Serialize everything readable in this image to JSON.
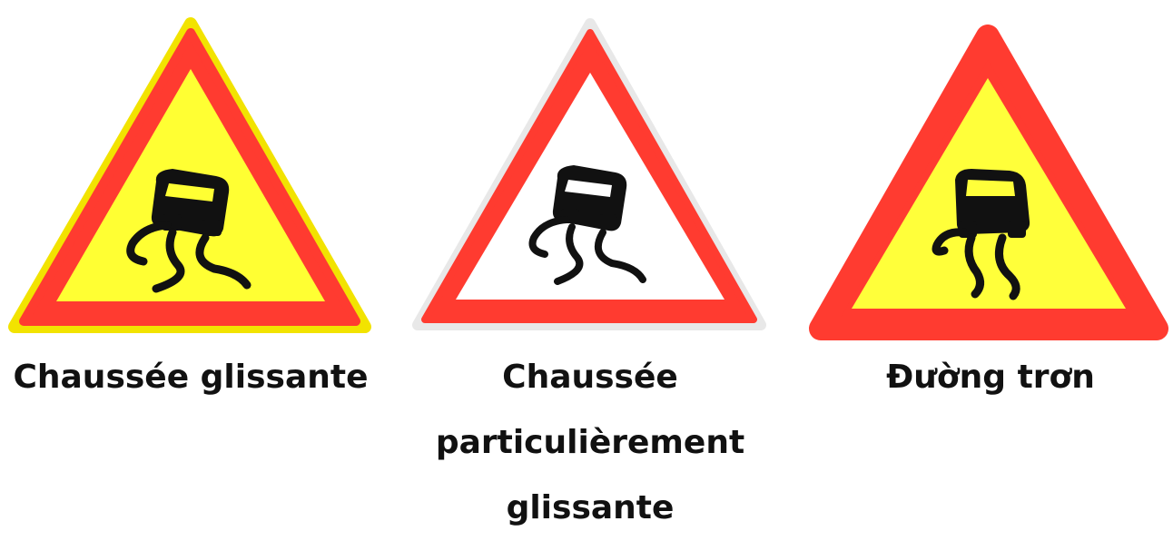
{
  "signs": [
    {
      "caption": "Chaussée glissante",
      "fill_color": "#ffff33",
      "border_color": "#ff3b30",
      "edge_color": "#f2e300",
      "icon": "skidding-car-icon"
    },
    {
      "caption": "Chaussée particulièrement glissante",
      "fill_color": "#ffffff",
      "border_color": "#ff3b30",
      "edge_color": "#e8e8e8",
      "icon": "skidding-car-icon"
    },
    {
      "caption": "Đường trơn",
      "fill_color": "#ffff3a",
      "border_color": "#ff3b30",
      "edge_color": "#ff3b30",
      "icon": "skidding-car-icon"
    }
  ]
}
